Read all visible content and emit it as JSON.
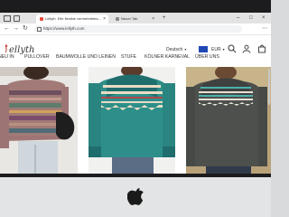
{
  "browser": {
    "tabs": [
      {
        "title": "Lellyth&nbsp; Elle flexible vermehrtetes...",
        "active": true
      },
      {
        "title": "Neuer Tab",
        "active": false
      }
    ],
    "new_tab_symbol": "+",
    "close_symbol": "×",
    "url": "https://www.lellyth.com",
    "window_controls": [
      "–",
      "□",
      "×"
    ]
  },
  "site": {
    "logo": "ellyth",
    "language": "Deutsch",
    "currency": "EUR",
    "nav": [
      "NEU IN",
      "PULLOVER",
      "BAUMWOLLE UND LEINEN",
      "STUFE",
      "KÖLNER KARNEVAL",
      "ÜBER UNS"
    ]
  },
  "icons": {
    "logo_mark": "lellyth-logo-icon",
    "search": "search-icon",
    "account": "user-icon",
    "cart": "cart-icon",
    "device": "apple-icon"
  },
  "colors": {
    "flag": "#1f48b5",
    "bezel": "#1c1c1e",
    "chin": "#e3e4e5"
  },
  "products": [
    {
      "name": "pink-fairisle-sweater"
    },
    {
      "name": "teal-yoke-sweater"
    },
    {
      "name": "charcoal-yoke-sweater"
    }
  ]
}
